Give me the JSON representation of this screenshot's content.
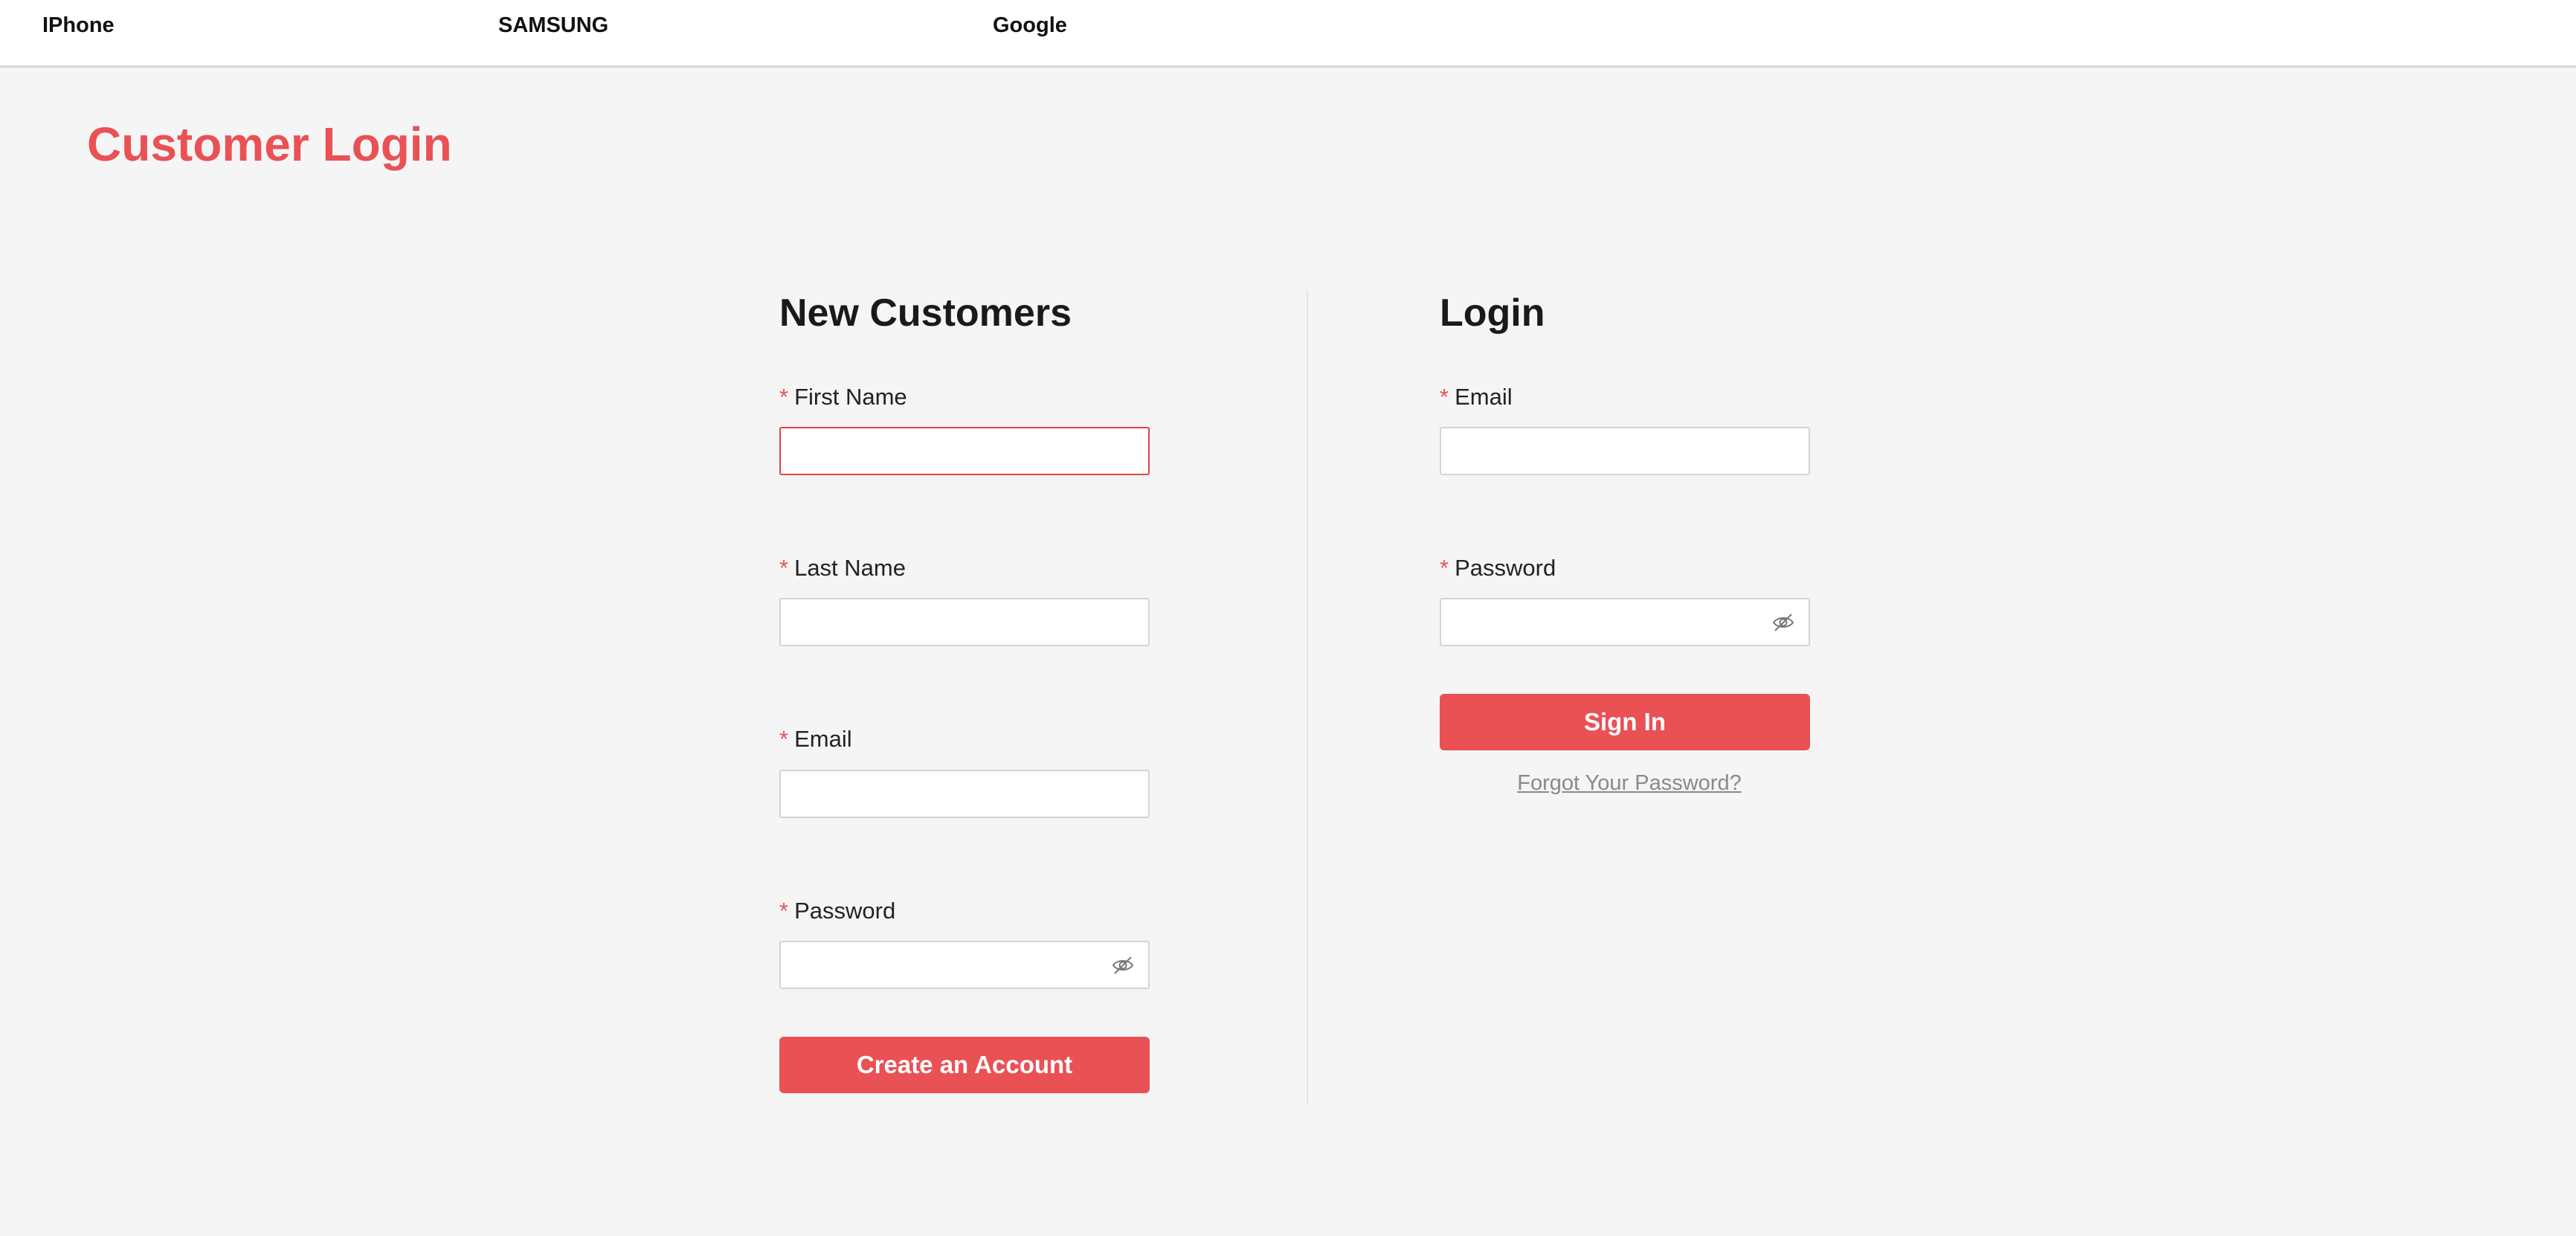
{
  "nav": {
    "items": [
      {
        "label": "IPhone"
      },
      {
        "label": "SAMSUNG"
      },
      {
        "label": "Google"
      }
    ]
  },
  "page": {
    "title": "Customer Login"
  },
  "new_customers": {
    "heading": "New Customers",
    "required_mark": "*",
    "first_name": {
      "label": "First Name",
      "value": ""
    },
    "last_name": {
      "label": "Last Name",
      "value": ""
    },
    "email": {
      "label": "Email",
      "value": ""
    },
    "password": {
      "label": "Password",
      "value": ""
    },
    "create_button_label": "Create an Account"
  },
  "login": {
    "heading": "Login",
    "required_mark": "*",
    "email": {
      "label": "Email",
      "value": ""
    },
    "password": {
      "label": "Password",
      "value": ""
    },
    "sign_in_label": "Sign In",
    "forgot_label": "Forgot Your Password?"
  },
  "icons": {
    "password_toggle": "eye-off-icon"
  },
  "colors": {
    "accent": "#e95155",
    "error_border": "#e0434a",
    "background": "#f5f5f5",
    "nav_background": "#ffffff"
  }
}
